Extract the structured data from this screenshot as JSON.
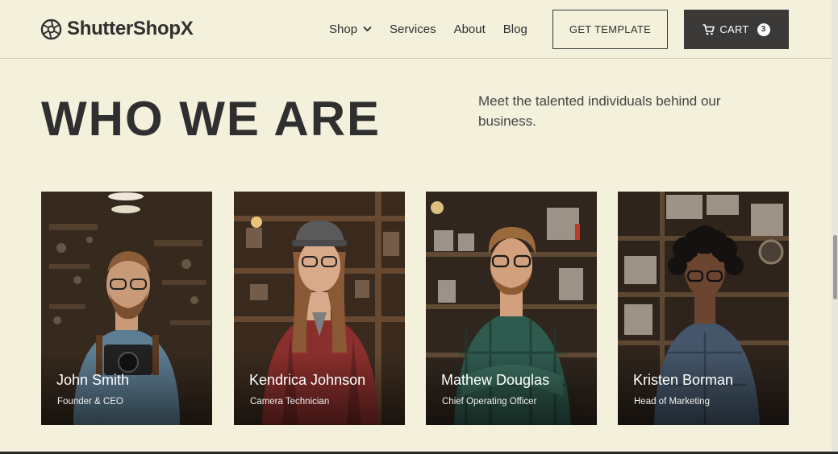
{
  "header": {
    "logo_text": "ShutterShopX",
    "nav": [
      {
        "label": "Shop"
      },
      {
        "label": "Services"
      },
      {
        "label": "About"
      },
      {
        "label": "Blog"
      }
    ],
    "get_template_label": "GET TEMPLATE",
    "cart_label": "CART",
    "cart_count": "3"
  },
  "hero": {
    "title": "WHO WE ARE",
    "description": "Meet the talented individuals behind our business."
  },
  "team": [
    {
      "name": "John Smith",
      "role": "Founder & CEO"
    },
    {
      "name": "Kendrica Johnson",
      "role": "Camera Technician"
    },
    {
      "name": "Mathew Douglas",
      "role": "Chief Operating Officer"
    },
    {
      "name": "Kristen Borman",
      "role": "Head of Marketing"
    }
  ],
  "colors": {
    "background": "#f3f0dc",
    "text_dark": "#2f2f2f",
    "cart_button": "#3a3938"
  }
}
